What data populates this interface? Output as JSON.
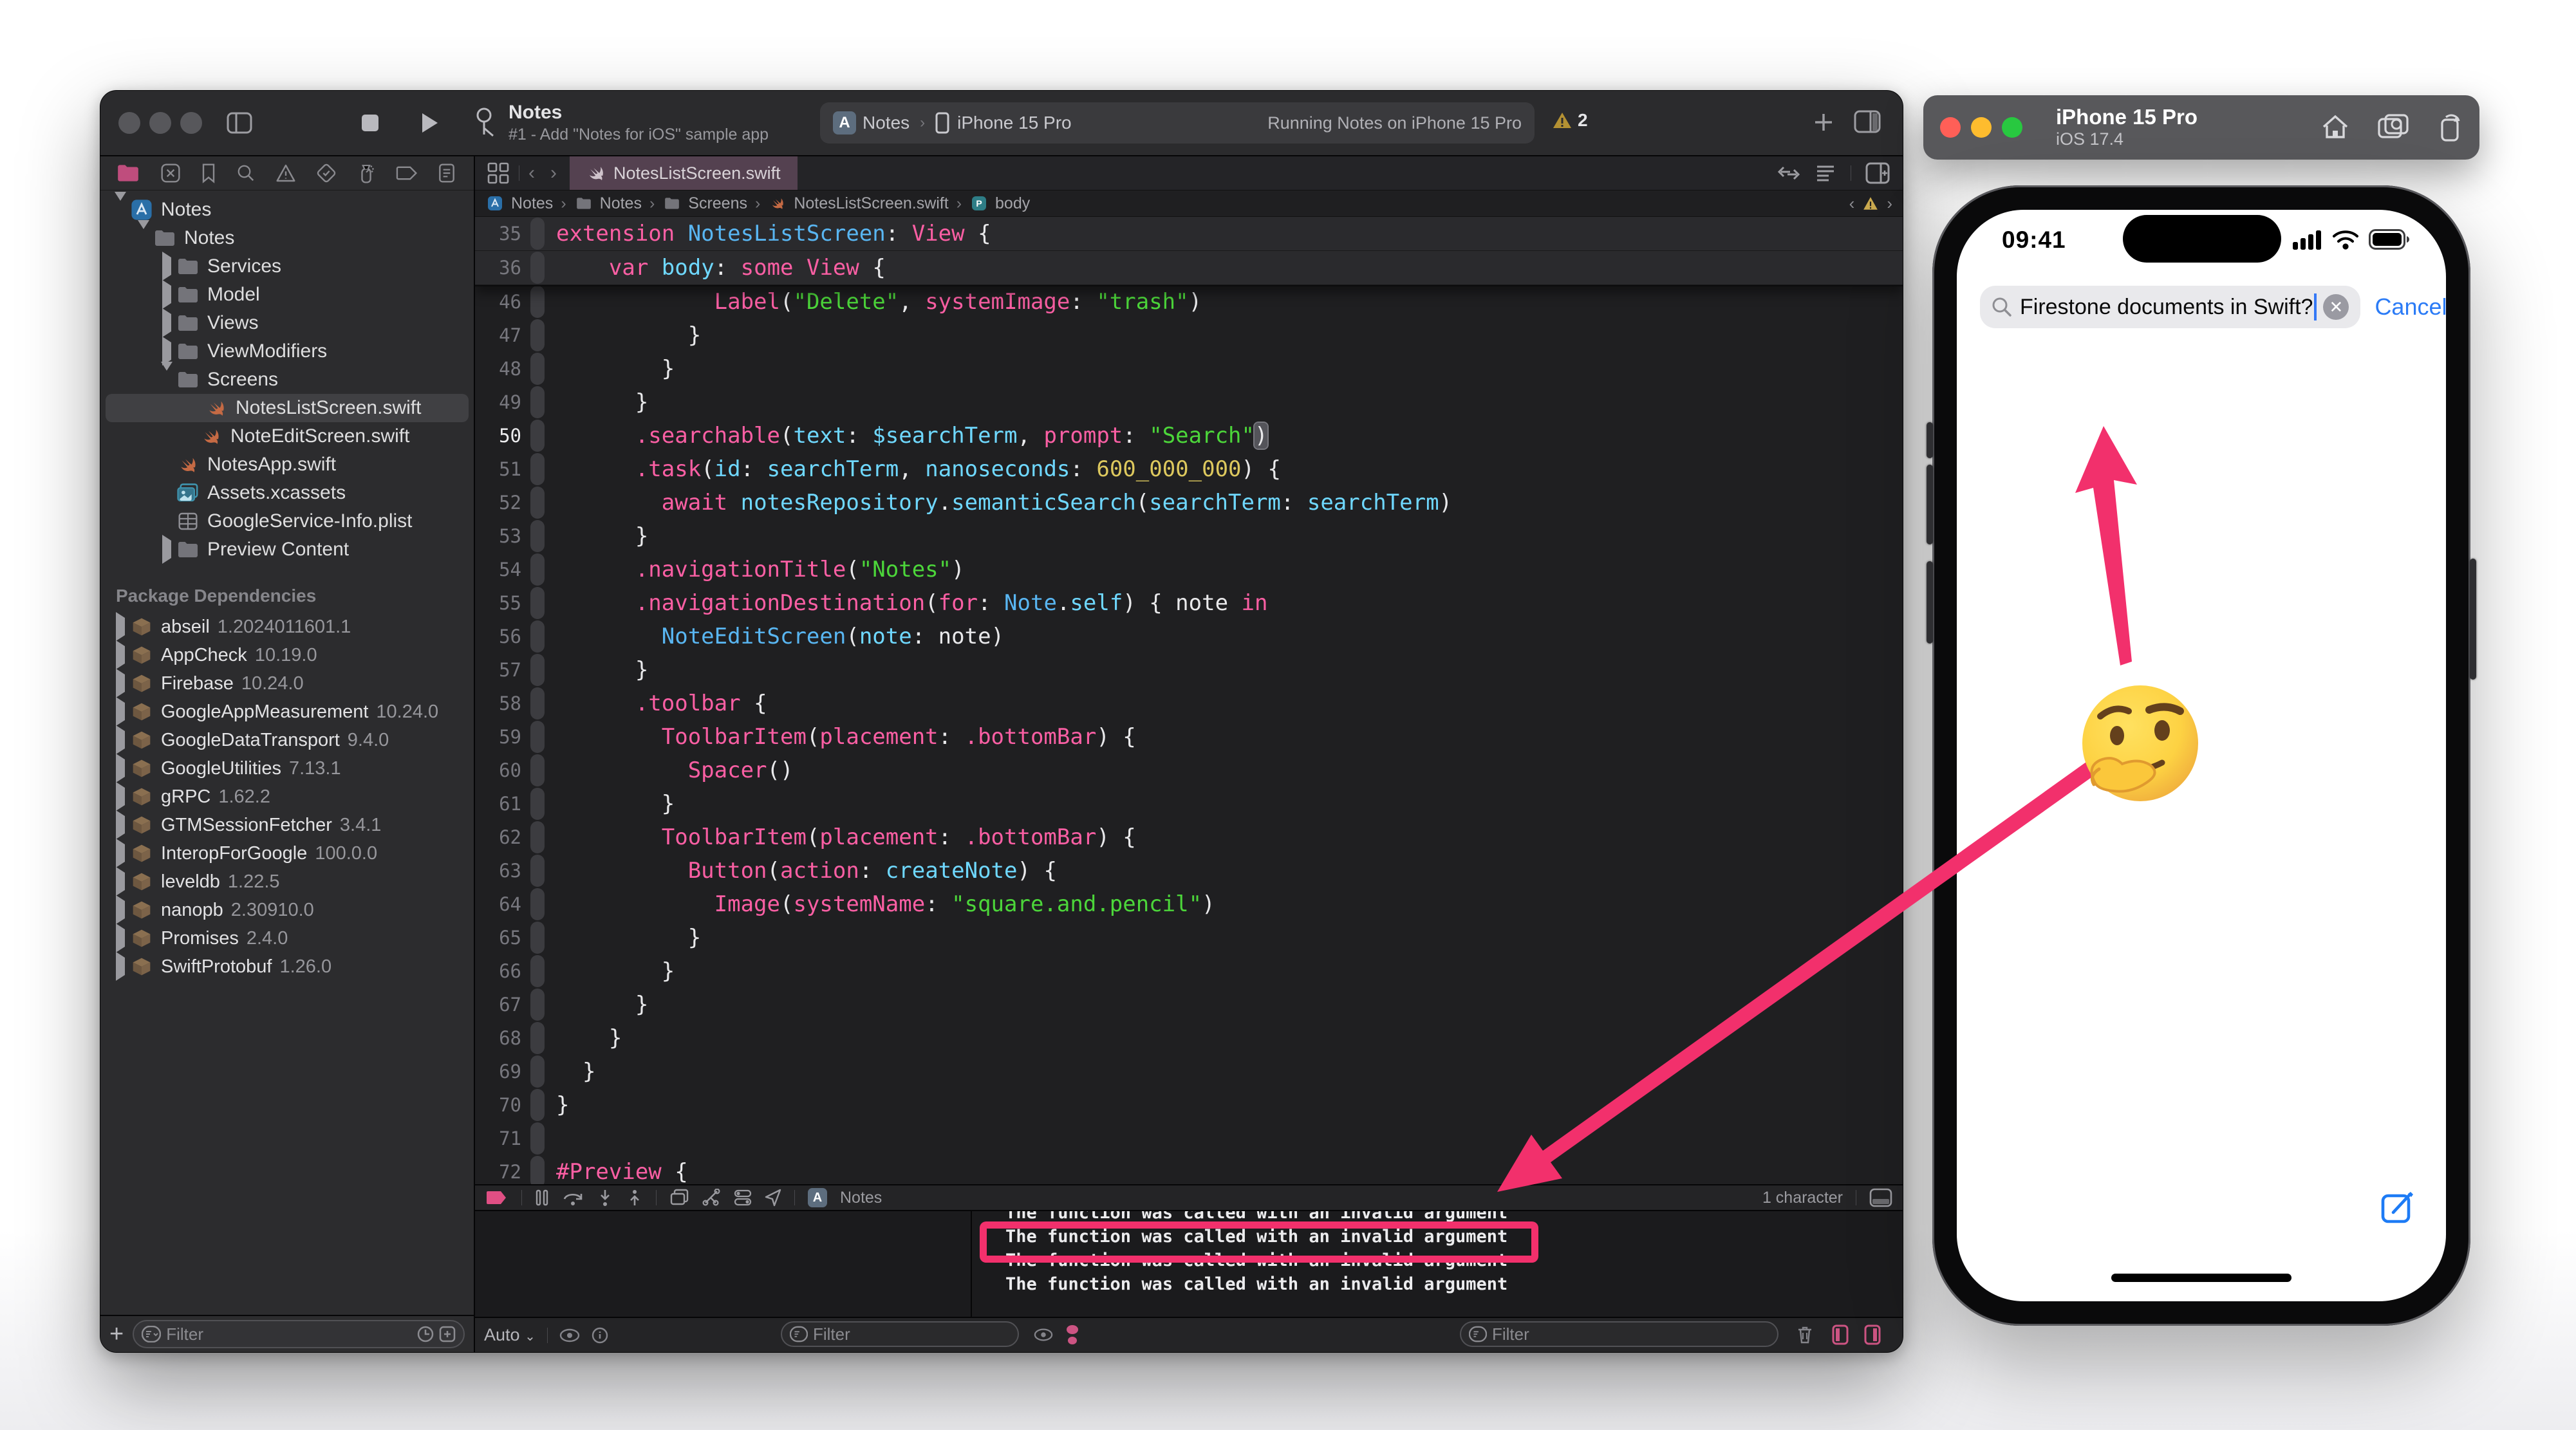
{
  "xcode": {
    "toolbar": {
      "title": "Notes",
      "subtitle": "#1 - Add \"Notes for iOS\" sample app",
      "scheme_app": "Notes",
      "scheme_device": "iPhone 15 Pro",
      "status": "Running Notes on iPhone 15 Pro",
      "warning_count": "2"
    },
    "navigator": {
      "tabs": [
        "project",
        "source-control",
        "bookmarks",
        "find",
        "issues",
        "tests",
        "debug",
        "breakpoints",
        "reports"
      ],
      "tree": [
        {
          "label": "Notes",
          "depth": 0,
          "icon": "app",
          "disc": "down"
        },
        {
          "label": "Notes",
          "depth": 1,
          "icon": "folder",
          "disc": "down"
        },
        {
          "label": "Services",
          "depth": 2,
          "icon": "folder",
          "disc": "right"
        },
        {
          "label": "Model",
          "depth": 2,
          "icon": "folder",
          "disc": "right"
        },
        {
          "label": "Views",
          "depth": 2,
          "icon": "folder",
          "disc": "right"
        },
        {
          "label": "ViewModifiers",
          "depth": 2,
          "icon": "folder",
          "disc": "right"
        },
        {
          "label": "Screens",
          "depth": 2,
          "icon": "folder",
          "disc": "down"
        },
        {
          "label": "NotesListScreen.swift",
          "depth": 3,
          "icon": "swift",
          "selected": true
        },
        {
          "label": "NoteEditScreen.swift",
          "depth": 3,
          "icon": "swift"
        },
        {
          "label": "NotesApp.swift",
          "depth": 2,
          "icon": "swift"
        },
        {
          "label": "Assets.xcassets",
          "depth": 2,
          "icon": "assets"
        },
        {
          "label": "GoogleService-Info.plist",
          "depth": 2,
          "icon": "plist"
        },
        {
          "label": "Preview Content",
          "depth": 2,
          "icon": "folder",
          "disc": "right"
        }
      ],
      "packages_header": "Package Dependencies",
      "packages": [
        {
          "name": "abseil",
          "version": "1.2024011601.1"
        },
        {
          "name": "AppCheck",
          "version": "10.19.0"
        },
        {
          "name": "Firebase",
          "version": "10.24.0"
        },
        {
          "name": "GoogleAppMeasurement",
          "version": "10.24.0"
        },
        {
          "name": "GoogleDataTransport",
          "version": "9.4.0"
        },
        {
          "name": "GoogleUtilities",
          "version": "7.13.1"
        },
        {
          "name": "gRPC",
          "version": "1.62.2"
        },
        {
          "name": "GTMSessionFetcher",
          "version": "3.4.1"
        },
        {
          "name": "InteropForGoogle",
          "version": "100.0.0"
        },
        {
          "name": "leveldb",
          "version": "1.22.5"
        },
        {
          "name": "nanopb",
          "version": "2.30910.0"
        },
        {
          "name": "Promises",
          "version": "2.4.0"
        },
        {
          "name": "SwiftProtobuf",
          "version": "1.26.0"
        }
      ],
      "filter_placeholder": "Filter"
    },
    "tabbar": {
      "active_tab": "NotesListScreen.swift"
    },
    "jumpbar": {
      "items": [
        {
          "icon": "app",
          "label": "Notes"
        },
        {
          "icon": "folder",
          "label": "Notes"
        },
        {
          "icon": "folder",
          "label": "Screens"
        },
        {
          "icon": "swift",
          "label": "NotesListScreen.swift"
        },
        {
          "icon": "pbadge",
          "label": "body"
        }
      ]
    },
    "code": {
      "lines": [
        {
          "n": "35",
          "sticky": true,
          "tokens": [
            [
              "k",
              "extension "
            ],
            [
              "t",
              "NotesListScreen"
            ],
            [
              "p",
              ": "
            ],
            [
              "k",
              "View"
            ],
            [
              "p",
              " {"
            ]
          ]
        },
        {
          "n": "36",
          "sticky": true,
          "tokens": [
            [
              "p",
              "    "
            ],
            [
              "k",
              "var "
            ],
            [
              "i",
              "body"
            ],
            [
              "p",
              ": "
            ],
            [
              "k",
              "some "
            ],
            [
              "k",
              "View"
            ],
            [
              "p",
              " {"
            ]
          ]
        },
        {
          "n": "46",
          "tokens": [
            [
              "p",
              "            "
            ],
            [
              "k",
              "Label"
            ],
            [
              "p",
              "("
            ],
            [
              "s",
              "\"Delete\""
            ],
            [
              "p",
              ", "
            ],
            [
              "k",
              "systemImage"
            ],
            [
              "p",
              ": "
            ],
            [
              "s",
              "\"trash\""
            ],
            [
              "p",
              ")"
            ]
          ]
        },
        {
          "n": "47",
          "tokens": [
            [
              "p",
              "          }"
            ]
          ]
        },
        {
          "n": "48",
          "tokens": [
            [
              "p",
              "        }"
            ]
          ]
        },
        {
          "n": "49",
          "tokens": [
            [
              "p",
              "      }"
            ]
          ]
        },
        {
          "n": "50",
          "active": true,
          "tokens": [
            [
              "p",
              "      "
            ],
            [
              "k",
              ".searchable"
            ],
            [
              "p",
              "("
            ],
            [
              "i",
              "text"
            ],
            [
              "p",
              ": "
            ],
            [
              "i",
              "$searchTerm"
            ],
            [
              "p",
              ", "
            ],
            [
              "k",
              "prompt"
            ],
            [
              "p",
              ": "
            ],
            [
              "s",
              "\"Search\""
            ],
            [
              "hl",
              ")"
            ]
          ]
        },
        {
          "n": "51",
          "tokens": [
            [
              "p",
              "      "
            ],
            [
              "k",
              ".task"
            ],
            [
              "p",
              "("
            ],
            [
              "i",
              "id"
            ],
            [
              "p",
              ": "
            ],
            [
              "i",
              "searchTerm"
            ],
            [
              "p",
              ", "
            ],
            [
              "i",
              "nanoseconds"
            ],
            [
              "p",
              ": "
            ],
            [
              "n2",
              "600_000_000"
            ],
            [
              "p",
              ") {"
            ]
          ]
        },
        {
          "n": "52",
          "tokens": [
            [
              "p",
              "        "
            ],
            [
              "k",
              "await "
            ],
            [
              "i",
              "notesRepository"
            ],
            [
              "p",
              "."
            ],
            [
              "i",
              "semanticSearch"
            ],
            [
              "p",
              "("
            ],
            [
              "i",
              "searchTerm"
            ],
            [
              "p",
              ": "
            ],
            [
              "i",
              "searchTerm"
            ],
            [
              "p",
              ")"
            ]
          ]
        },
        {
          "n": "53",
          "tokens": [
            [
              "p",
              "      }"
            ]
          ]
        },
        {
          "n": "54",
          "tokens": [
            [
              "p",
              "      "
            ],
            [
              "k",
              ".navigationTitle"
            ],
            [
              "p",
              "("
            ],
            [
              "s",
              "\"Notes\""
            ],
            [
              "p",
              ")"
            ]
          ]
        },
        {
          "n": "55",
          "tokens": [
            [
              "p",
              "      "
            ],
            [
              "k",
              ".navigationDestination"
            ],
            [
              "p",
              "("
            ],
            [
              "k",
              "for"
            ],
            [
              "p",
              ": "
            ],
            [
              "t",
              "Note"
            ],
            [
              "p",
              "."
            ],
            [
              "i",
              "self"
            ],
            [
              "p",
              ") { note "
            ],
            [
              "k",
              "in"
            ]
          ]
        },
        {
          "n": "56",
          "tokens": [
            [
              "p",
              "        "
            ],
            [
              "t",
              "NoteEditScreen"
            ],
            [
              "p",
              "("
            ],
            [
              "i",
              "note"
            ],
            [
              "p",
              ": note)"
            ]
          ]
        },
        {
          "n": "57",
          "tokens": [
            [
              "p",
              "      }"
            ]
          ]
        },
        {
          "n": "58",
          "tokens": [
            [
              "p",
              "      "
            ],
            [
              "k",
              ".toolbar"
            ],
            [
              "p",
              " {"
            ]
          ]
        },
        {
          "n": "59",
          "tokens": [
            [
              "p",
              "        "
            ],
            [
              "k",
              "ToolbarItem"
            ],
            [
              "p",
              "("
            ],
            [
              "k",
              "placement"
            ],
            [
              "p",
              ": "
            ],
            [
              "k",
              ".bottomBar"
            ],
            [
              "p",
              ") {"
            ]
          ]
        },
        {
          "n": "60",
          "tokens": [
            [
              "p",
              "          "
            ],
            [
              "k",
              "Spacer"
            ],
            [
              "p",
              "()"
            ]
          ]
        },
        {
          "n": "61",
          "tokens": [
            [
              "p",
              "        }"
            ]
          ]
        },
        {
          "n": "62",
          "tokens": [
            [
              "p",
              "        "
            ],
            [
              "k",
              "ToolbarItem"
            ],
            [
              "p",
              "("
            ],
            [
              "k",
              "placement"
            ],
            [
              "p",
              ": "
            ],
            [
              "k",
              ".bottomBar"
            ],
            [
              "p",
              ") {"
            ]
          ]
        },
        {
          "n": "63",
          "tokens": [
            [
              "p",
              "          "
            ],
            [
              "k",
              "Button"
            ],
            [
              "p",
              "("
            ],
            [
              "k",
              "action"
            ],
            [
              "p",
              ": "
            ],
            [
              "i",
              "createNote"
            ],
            [
              "p",
              ") {"
            ]
          ]
        },
        {
          "n": "64",
          "tokens": [
            [
              "p",
              "            "
            ],
            [
              "k",
              "Image"
            ],
            [
              "p",
              "("
            ],
            [
              "k",
              "systemName"
            ],
            [
              "p",
              ": "
            ],
            [
              "s",
              "\"square.and.pencil\""
            ],
            [
              "p",
              ")"
            ]
          ]
        },
        {
          "n": "65",
          "tokens": [
            [
              "p",
              "          }"
            ]
          ]
        },
        {
          "n": "66",
          "tokens": [
            [
              "p",
              "        }"
            ]
          ]
        },
        {
          "n": "67",
          "tokens": [
            [
              "p",
              "      }"
            ]
          ]
        },
        {
          "n": "68",
          "tokens": [
            [
              "p",
              "    }"
            ]
          ]
        },
        {
          "n": "69",
          "tokens": [
            [
              "p",
              "  }"
            ]
          ]
        },
        {
          "n": "70",
          "tokens": [
            [
              "p",
              "}"
            ]
          ]
        },
        {
          "n": "71",
          "tokens": []
        },
        {
          "n": "72",
          "tokens": [
            [
              "k",
              "#Preview"
            ],
            [
              "p",
              " {"
            ]
          ]
        }
      ]
    },
    "debugbar": {
      "app_label": "Notes",
      "char_count": "1 character"
    },
    "console": {
      "lines": [
        "The function was called with an invalid argument",
        "The function was called with an invalid argument",
        "The function was called with an invalid argument",
        "The function was called with an invalid argument"
      ],
      "boxed_line_index": 1
    },
    "bottom_bar": {
      "auto_label": "Auto",
      "filter_placeholder": "Filter"
    }
  },
  "simulator": {
    "title": "iPhone 15 Pro",
    "os": "iOS 17.4",
    "time": "09:41",
    "search_text": "Firestone documents in Swift?",
    "cancel_label": "Cancel"
  },
  "annotations": {
    "emoji": "thinking-face",
    "accent_color": "#f2306c",
    "highlighted_console_line": "The function was called with an invalid argument"
  },
  "colors": {
    "keyword_pink": "#fb5fa4",
    "type_blue": "#59b6f2",
    "identifier_cyan": "#6fd8ff",
    "string_green": "#4cd63a",
    "number_yellow": "#ddc85e",
    "annotation_pink": "#f2306c",
    "cancel_blue": "#2b7bf6",
    "swift_orange": "#ed7d4e"
  }
}
